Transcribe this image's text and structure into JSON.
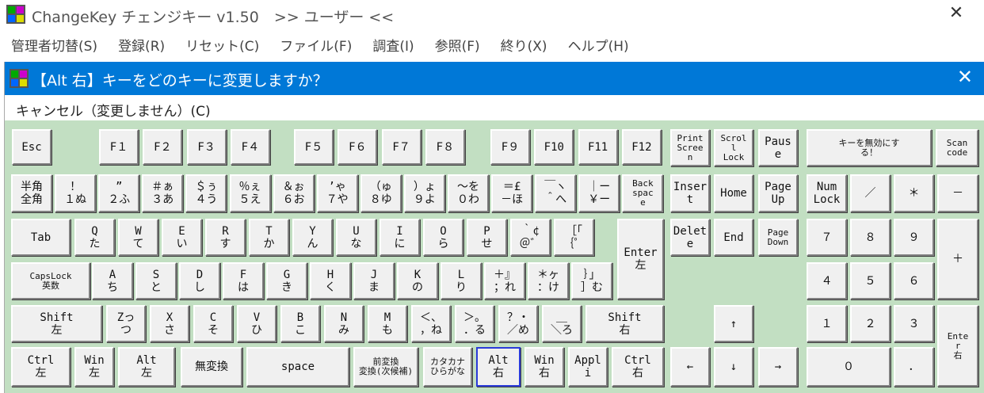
{
  "window": {
    "title": "ChangeKey チェンジキー v1.50　>> ユーザー <<",
    "close": "✕"
  },
  "menu": [
    "管理者切替(S)",
    "登録(R)",
    "リセット(C)",
    "ファイル(F)",
    "調査(I)",
    "参照(F)",
    "終り(X)",
    "ヘルプ(H)"
  ],
  "dialog": {
    "title": "【Alt 右】キーをどのキーに変更しますか？",
    "close": "✕",
    "cancel": "キャンセル（変更しません）(C)"
  },
  "selected_key": "Alt\n右",
  "keys": [
    "Esc",
    "F１",
    "F２",
    "F３",
    "F４",
    "F５",
    "F６",
    "F７",
    "F８",
    "F９",
    "F10",
    "F11",
    "F12",
    "Print\nScree\nn",
    "Scrol\nl\nLock",
    "Paus\ne",
    "キーを無効にす\nる！",
    "Scan\ncode",
    "半角\n全角",
    "！\n１ぬ",
    "”\n２ふ",
    "＃ぁ\n３あ",
    "＄ぅ\n４う",
    "％ぇ\n５え",
    "＆ぉ\n６お",
    "’ゃ\n７や",
    "（ゅ\n８ゆ",
    "）ょ\n９よ",
    "～を\n０わ",
    "＝£\n－ほ",
    "￣ヽ\n＾へ",
    "｜ー\n￥ー",
    "Back\nspac\ne",
    "Tab",
    "Q\nた",
    "W\nて",
    "E\nい",
    "R\nす",
    "T\nか",
    "Y\nん",
    "U\nな",
    "I\nに",
    "O\nら",
    "P\nせ",
    "｀¢\n＠゛",
    "［「\n｛゜",
    "Enter\n左",
    "CapsLock\n英数",
    "A\nち",
    "S\nと",
    "D\nし",
    "F\nは",
    "G\nき",
    "H\nく",
    "J\nま",
    "K\nの",
    "L\nり",
    "＋』\n；れ",
    "＊ヶ\n：け",
    "｝」\n］む",
    "Shift\n左",
    "Zっ\nつ",
    "X\nさ",
    "C\nそ",
    "V\nひ",
    "B\nこ",
    "N\nみ",
    "M\nも",
    "＜、\n，ね",
    "＞。\n．る",
    "？・\n／め",
    "＿\n＼ろ",
    "Shift\n右",
    "Ctrl\n左",
    "Win\n左",
    "Alt\n左",
    "無変換",
    "space",
    "前変換\n変換(次候補)",
    "カタカナ\nひらがな",
    "Alt\n右",
    "Win\n右",
    "Appl\ni",
    "Ctrl\n右",
    "Inser\nt",
    "Home",
    "Page\nUp",
    "Delet\ne",
    "End",
    "Page\nDown",
    "↑",
    "←",
    "↓",
    "→",
    "Num\nLock",
    "／",
    "＊",
    "－",
    "７",
    "８",
    "９",
    "＋",
    "４",
    "５",
    "６",
    "１",
    "２",
    "３",
    "Ente\nr\n右",
    "０",
    "．"
  ]
}
